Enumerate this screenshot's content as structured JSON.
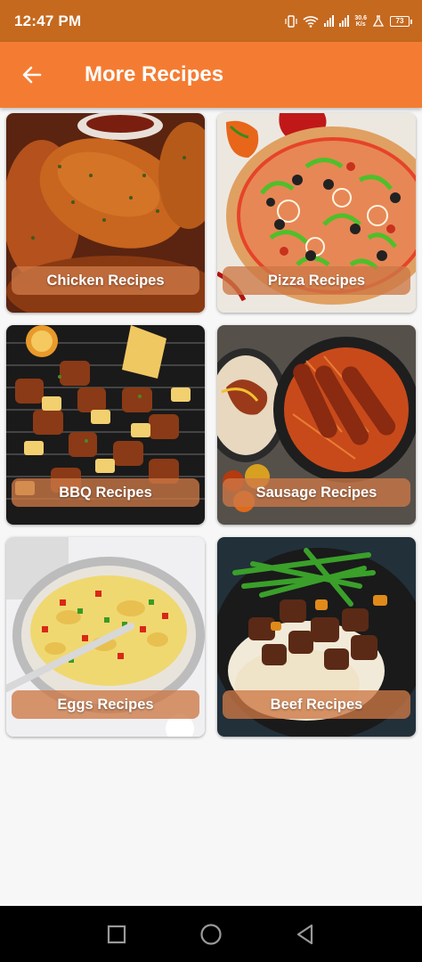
{
  "status_bar": {
    "time": "12:47 PM",
    "net_speed_value": "30.6",
    "net_speed_unit": "K/s",
    "battery": "73",
    "icons": [
      "vibrate-icon",
      "wifi-icon",
      "signal-icon",
      "signal-icon",
      "flask-icon",
      "battery-icon"
    ]
  },
  "app_bar": {
    "title": "More Recipes",
    "back_icon": "arrow-left-icon",
    "background": "#f47c32"
  },
  "recipes": [
    {
      "label": "Chicken Recipes"
    },
    {
      "label": "Pizza Recipes"
    },
    {
      "label": "BBQ Recipes"
    },
    {
      "label": "Sausage Recipes"
    },
    {
      "label": "Eggs Recipes"
    },
    {
      "label": "Beef Recipes"
    }
  ],
  "nav_bar": {
    "icons": [
      "recent-apps-icon",
      "home-icon",
      "back-triangle-icon"
    ]
  }
}
